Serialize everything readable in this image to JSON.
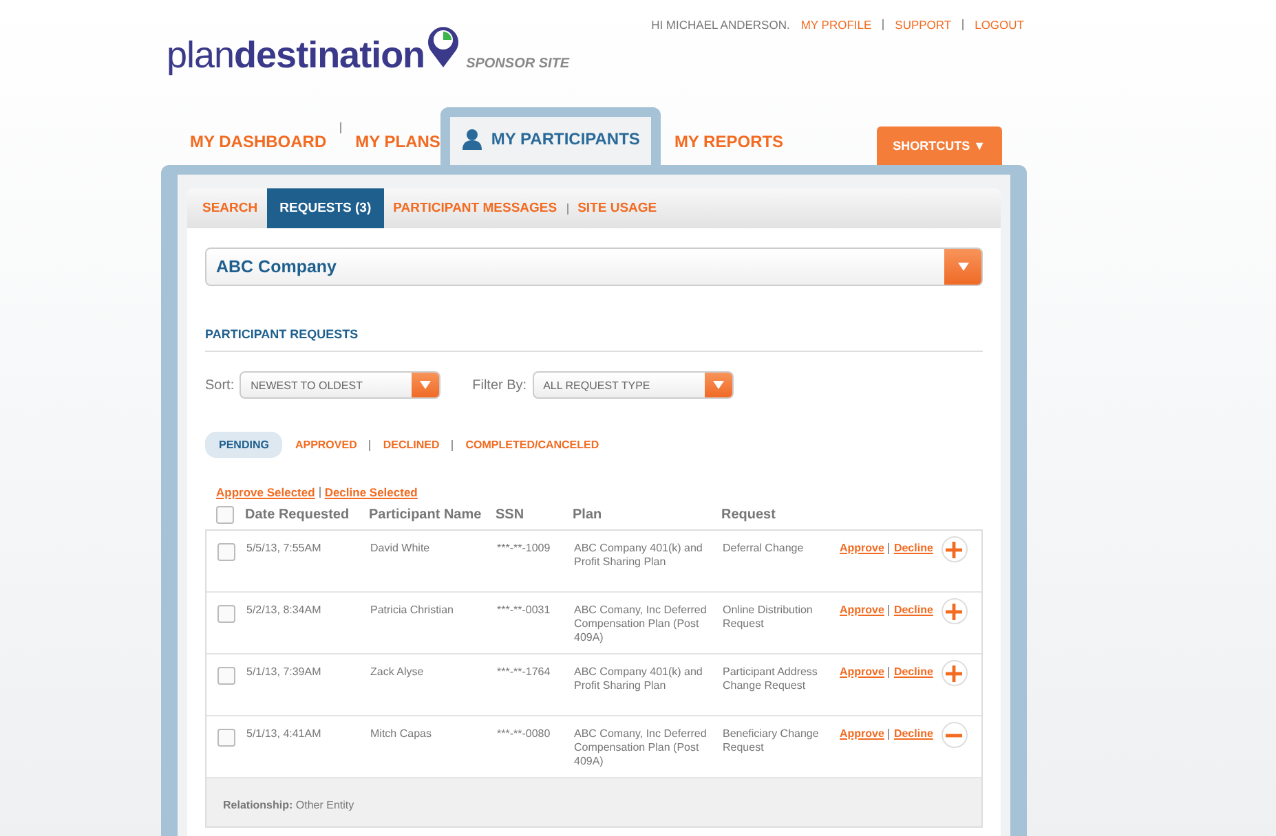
{
  "header": {
    "logo": "plan**destination**",
    "logo_sub": "SPONSOR SITE",
    "greeting": "HI MICHAEL ANDERSON.",
    "links": [
      "MY PROFILE",
      "SUPPORT",
      "LOGOUT"
    ]
  },
  "nav": {
    "tabs": [
      {
        "label": "MY DASHBOARD",
        "selected": false,
        "icon": false
      },
      {
        "label": "MY PLANS",
        "selected": false,
        "icon": false
      },
      {
        "label": "MY PARTICIPANTS",
        "selected": true,
        "icon": true
      },
      {
        "label": "MY REPORTS",
        "selected": false,
        "icon": false
      }
    ],
    "shortcuts": "SHORTCUTS ▼"
  },
  "subtabs": [
    {
      "label": "SEARCH",
      "selected": false
    },
    {
      "label": "REQUESTS (3)",
      "selected": true
    },
    {
      "label": "PARTICIPANT MESSAGES",
      "selected": false
    },
    {
      "label": "SITE USAGE",
      "selected": false
    }
  ],
  "company": {
    "value": "ABC Company"
  },
  "section_title": "PARTICIPANT REQUESTS",
  "sort": {
    "label": "Sort:",
    "value": "NEWEST TO OLDEST"
  },
  "filter": {
    "label": "Filter By:",
    "value": "ALL REQUEST TYPE"
  },
  "status_tabs": [
    {
      "label": "PENDING",
      "selected": true
    },
    {
      "label": "APPROVED",
      "selected": false
    },
    {
      "label": "DECLINED",
      "selected": false
    },
    {
      "label": "COMPLETED/CANCELED",
      "selected": false
    }
  ],
  "bulk_actions": [
    "Approve Selected",
    "Decline Selected"
  ],
  "table": {
    "select_all_checked": false,
    "columns": [
      "Date Requested",
      "Participant Name",
      "SSN",
      "Plan",
      "Request"
    ],
    "rows": [
      {
        "date": "5/5/13, 7:55AM",
        "name": "David White",
        "ssn": "***-**-1009",
        "plan": "ABC Company 401(k) and Profit Sharing Plan",
        "request": "Deferral Change",
        "checked": false,
        "expanded": false,
        "approve": "Approve",
        "decline": "Decline"
      },
      {
        "date": "5/2/13, 8:34AM",
        "name": "Patricia Christian",
        "ssn": "***-**-0031",
        "plan": "ABC Comany, Inc Deferred Compensation Plan (Post 409A)",
        "request": "Online Distribution Request",
        "checked": false,
        "expanded": false,
        "approve": "Approve",
        "decline": "Decline"
      },
      {
        "date": "5/1/13, 7:39AM",
        "name": "Zack Alyse",
        "ssn": "***-**-1764",
        "plan": "ABC Company 401(k) and Profit Sharing Plan",
        "request": "Participant Address Change Request",
        "checked": false,
        "expanded": false,
        "approve": "Approve",
        "decline": "Decline"
      },
      {
        "date": "5/1/13, 4:41AM",
        "name": "Mitch Capas",
        "ssn": "***-**-0080",
        "plan": "ABC Comany, Inc Deferred Compensation Plan (Post 409A)",
        "request": "Beneficiary Change Request",
        "checked": false,
        "expanded": true,
        "approve": "Approve",
        "decline": "Decline",
        "detail": "**Relationship:** Other Entity"
      }
    ]
  }
}
